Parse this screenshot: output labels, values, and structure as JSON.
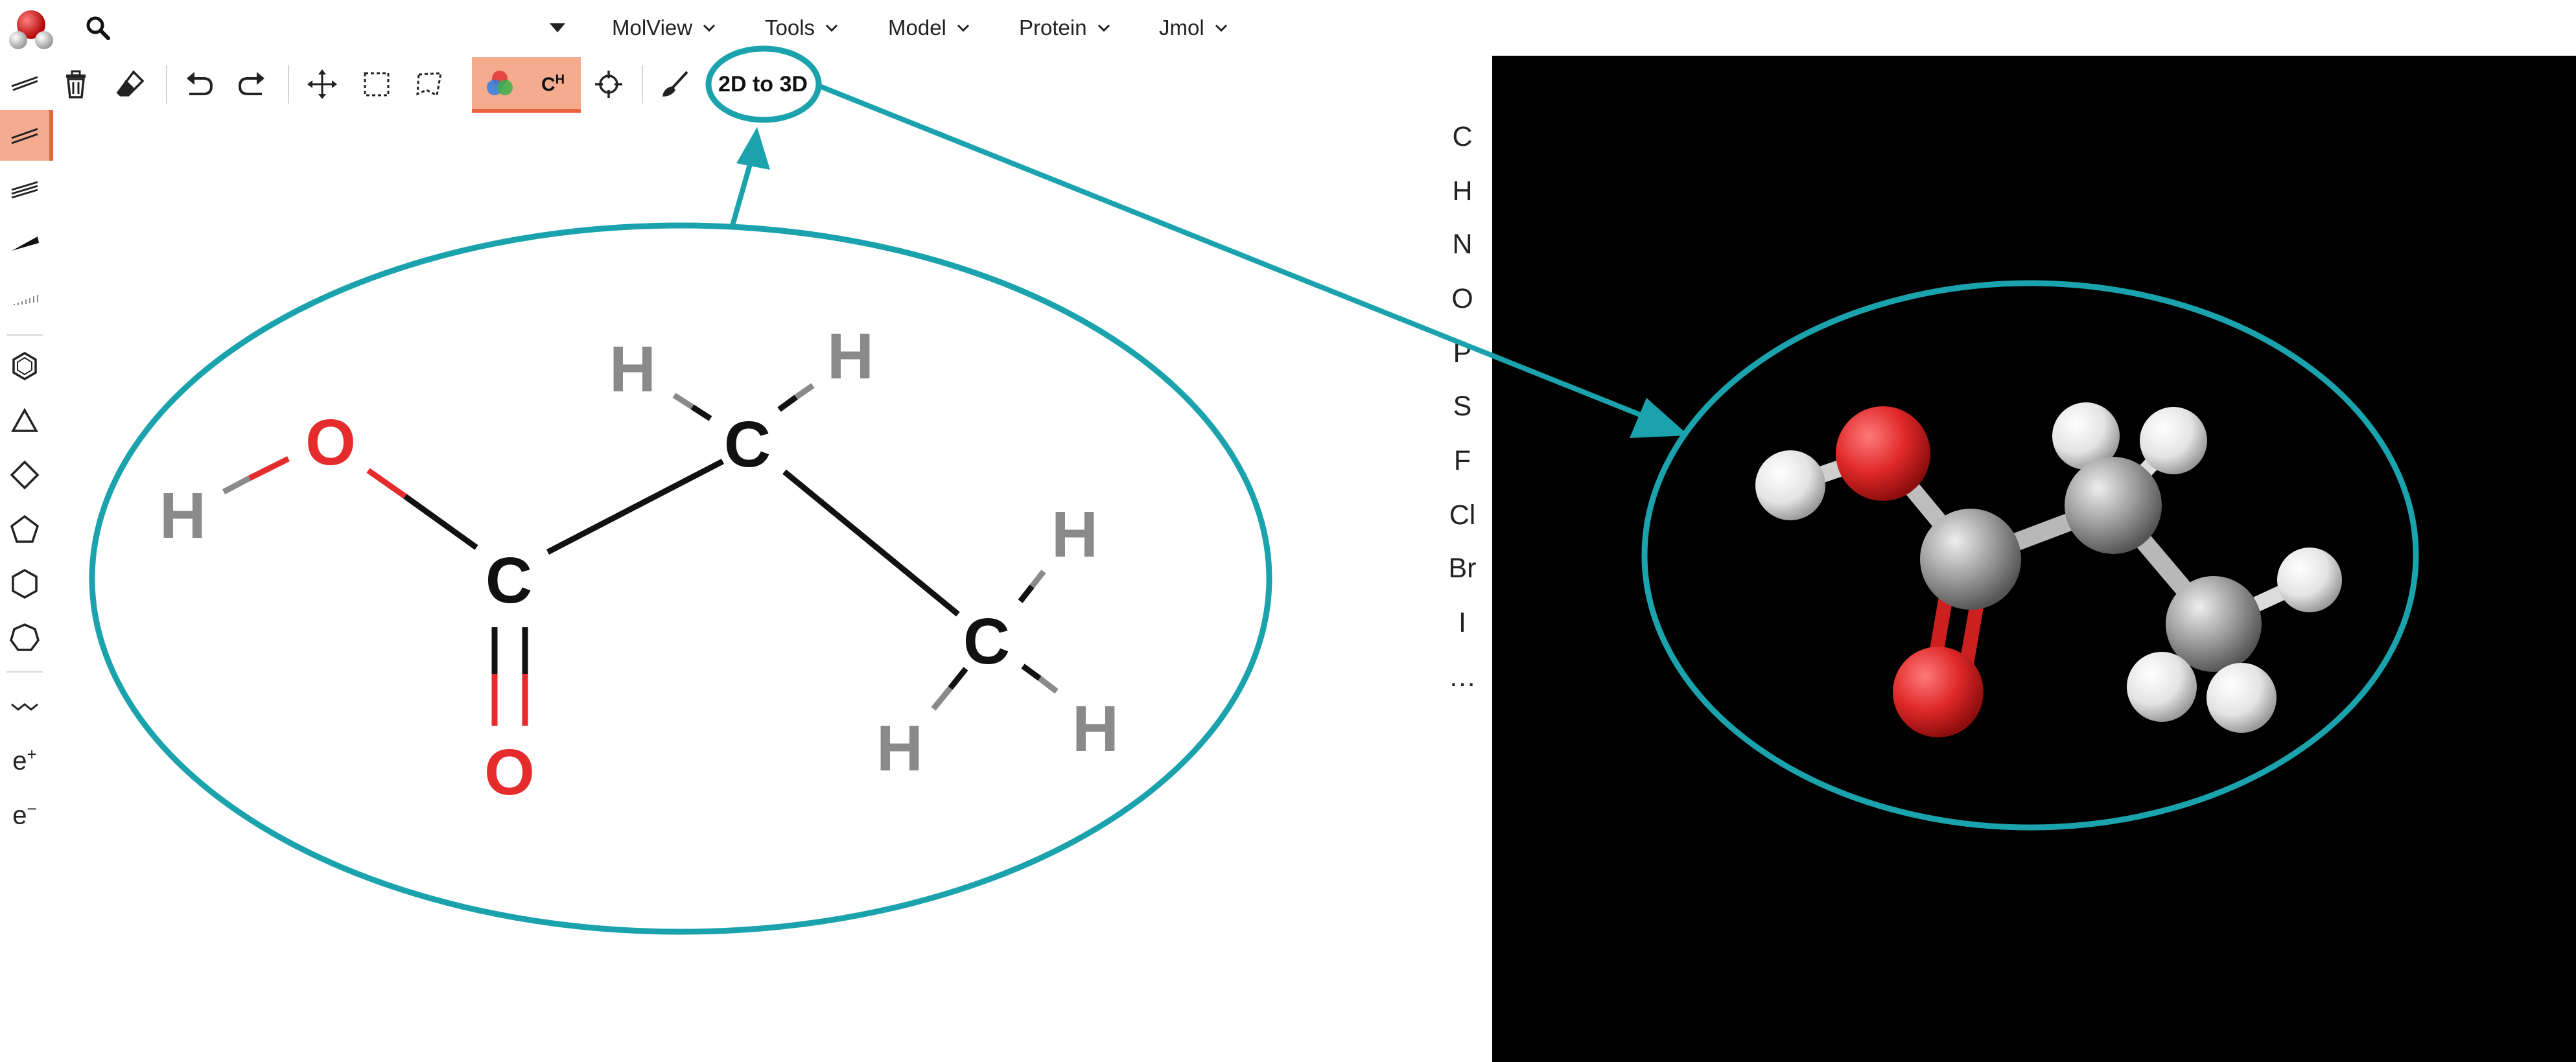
{
  "app": {
    "logo_icon": "molecule-logo-icon",
    "search_icon": "search-icon"
  },
  "menu": {
    "items": [
      {
        "label": "MolView"
      },
      {
        "label": "Tools"
      },
      {
        "label": "Model"
      },
      {
        "label": "Protein"
      },
      {
        "label": "Jmol"
      }
    ]
  },
  "toolbar": {
    "tools": [
      "single-bond-icon",
      "trash-icon",
      "eraser-icon",
      "undo-icon",
      "redo-icon",
      "move-icon",
      "rectangle-select-icon",
      "lasso-select-icon",
      "color-mode-icon",
      "hydrogen-toggle-icon",
      "center-icon",
      "clean-brush-icon"
    ],
    "hydrogen_label": "C",
    "hydrogen_sup": "H",
    "convert_label": "2D to 3D"
  },
  "left_tools": {
    "items": [
      "single-bond-icon",
      "double-bond-icon",
      "triple-bond-icon",
      "wedge-bond-icon",
      "hash-bond-icon",
      "benzene-icon",
      "cyclopropane-icon",
      "cyclobutane-icon",
      "cyclopentane-icon",
      "cyclohexane-icon",
      "cycloheptane-icon",
      "chain-icon"
    ],
    "charge_plus": "e",
    "charge_plus_sup": "+",
    "charge_minus": "e",
    "charge_minus_sup": "−"
  },
  "elements": [
    "C",
    "H",
    "N",
    "O",
    "P",
    "S",
    "F",
    "Cl",
    "Br",
    "I",
    "…"
  ],
  "molecule_2d": {
    "atoms": [
      {
        "label": "O",
        "color": "#e52b2b"
      },
      {
        "label": "H",
        "color": "#8a8a8a"
      },
      {
        "label": "C",
        "color": "#111111"
      },
      {
        "label": "O",
        "color": "#e52b2b"
      },
      {
        "label": "C",
        "color": "#111111"
      },
      {
        "label": "H",
        "color": "#8a8a8a"
      },
      {
        "label": "H",
        "color": "#8a8a8a"
      },
      {
        "label": "C",
        "color": "#111111"
      },
      {
        "label": "H",
        "color": "#8a8a8a"
      },
      {
        "label": "H",
        "color": "#8a8a8a"
      },
      {
        "label": "H",
        "color": "#8a8a8a"
      }
    ]
  },
  "colors": {
    "accent": "#f4ab8e",
    "accent_border": "#e8643c",
    "annotation": "#1aa3ad",
    "oxygen": "#e52b2b",
    "hydrogen": "#8a8a8a",
    "carbon": "#111111",
    "viewer_bg": "#000000"
  }
}
